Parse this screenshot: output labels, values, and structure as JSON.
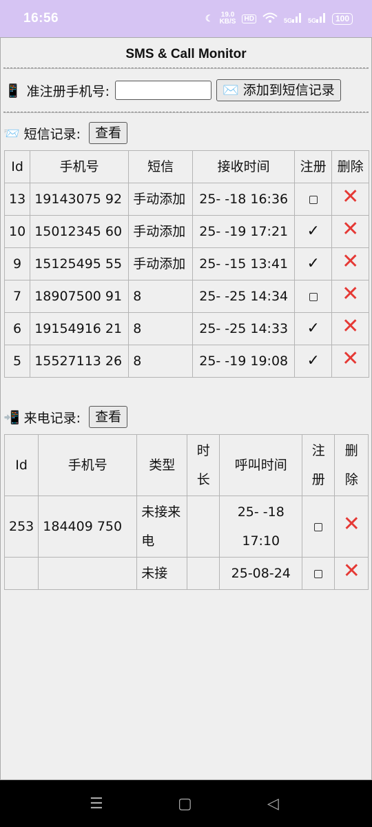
{
  "status": {
    "time": "16:56",
    "net_speed": "19.0",
    "net_unit": "KB/S",
    "hd": "HD",
    "sig1": "5G",
    "sig2": "5G",
    "battery": "100"
  },
  "title": "SMS & Call Monitor",
  "register": {
    "label": "准注册手机号:",
    "input_value": "",
    "button_label": "添加到短信记录",
    "phone_icon": "📱",
    "mail_icon": "✉️"
  },
  "sms": {
    "label": "短信记录:",
    "view_button": "查看",
    "icon": "📨",
    "headers": [
      "Id",
      "手机号",
      "短信",
      "接收时间",
      "注册",
      "删除"
    ],
    "rows": [
      {
        "id": "13",
        "phone": "19143075 92",
        "msg": "手动添加",
        "time": "25- -18 16:36",
        "registered": false
      },
      {
        "id": "10",
        "phone": "15012345 60",
        "msg": "手动添加",
        "time": "25- -19 17:21",
        "registered": true
      },
      {
        "id": "9",
        "phone": "15125495 55",
        "msg": "手动添加",
        "time": "25- -15 13:41",
        "registered": true
      },
      {
        "id": "7",
        "phone": "18907500 91",
        "msg": "8",
        "time": "25- -25 14:34",
        "registered": false
      },
      {
        "id": "6",
        "phone": "19154916 21",
        "msg": "8",
        "time": "25- -25 14:33",
        "registered": true
      },
      {
        "id": "5",
        "phone": "15527113 26",
        "msg": "8",
        "time": "25- -19 19:08",
        "registered": true
      }
    ]
  },
  "calls": {
    "label": "来电记录:",
    "view_button": "查看",
    "icon": "📲",
    "headers": [
      "Id",
      "手机号",
      "类型",
      "时长",
      "呼叫时间",
      "注册",
      "删除"
    ],
    "rows": [
      {
        "id": "253",
        "phone": "184409 750",
        "type": "未接来电",
        "duration": "",
        "time": "25- -18 17:10",
        "registered": false
      },
      {
        "id": "",
        "phone": "",
        "type": "未接",
        "duration": "",
        "time": "25-08-24",
        "registered": false
      }
    ]
  },
  "icons": {
    "delete": "cross-icon",
    "check": "checkmark-icon",
    "unchecked": "checkbox-icon"
  },
  "colors": {
    "status_bar": "#d6c4f3",
    "delete": "#e53935",
    "background": "#efefef"
  }
}
